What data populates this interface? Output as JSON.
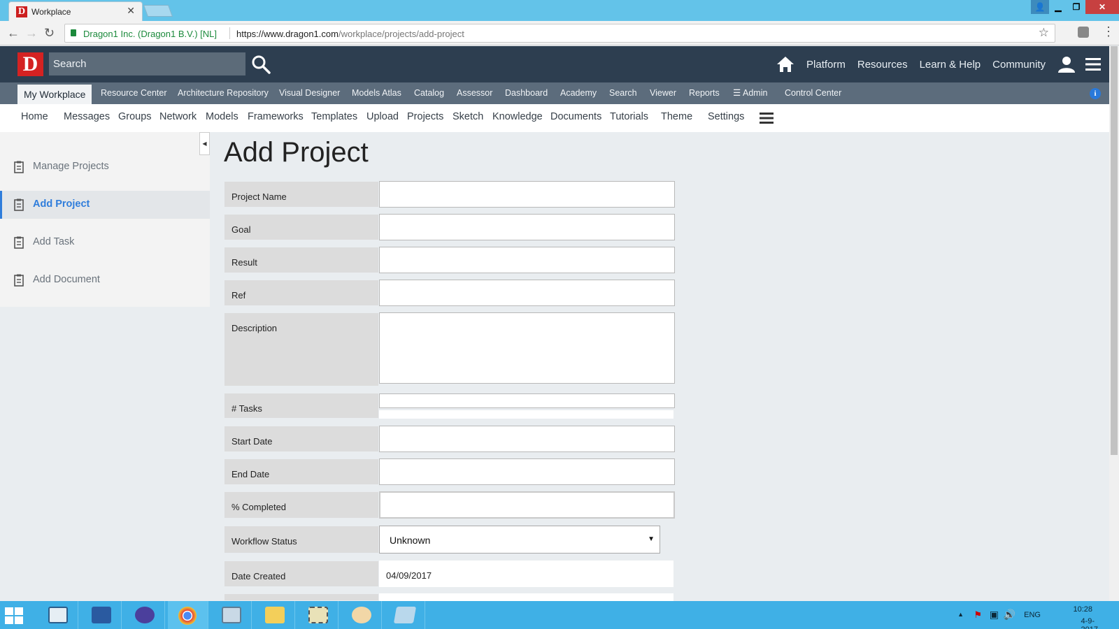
{
  "browser": {
    "tab_title": "Workplace",
    "org": "Dragon1 Inc. (Dragon1 B.V.) [NL]",
    "url_host": "https://www.dragon1.com",
    "url_path": "/workplace/projects/add-project"
  },
  "header": {
    "logo_letter": "D",
    "search_placeholder": "Search",
    "links": [
      "Platform",
      "Resources",
      "Learn & Help",
      "Community"
    ]
  },
  "modules": {
    "active": "My Workplace",
    "items": [
      "Resource Center",
      "Architecture Repository",
      "Visual Designer",
      "Models Atlas",
      "Catalog",
      "Assessor",
      "Dashboard",
      "Academy",
      "Search",
      "Viewer",
      "Reports",
      "Admin",
      "Control Center"
    ]
  },
  "subnav": [
    "Home",
    "Messages",
    "Groups",
    "Network",
    "Models",
    "Frameworks",
    "Templates",
    "Upload",
    "Projects",
    "Sketch",
    "Knowledge",
    "Documents",
    "Tutorials",
    "Theme",
    "Settings"
  ],
  "sidebar": {
    "items": [
      {
        "label": "Manage Projects"
      },
      {
        "label": "Add Project"
      },
      {
        "label": "Add Task"
      },
      {
        "label": "Add Document"
      }
    ]
  },
  "form": {
    "title": "Add Project",
    "fields": {
      "project_name": "Project Name",
      "goal": "Goal",
      "result": "Result",
      "ref": "Ref",
      "description": "Description",
      "tasks": "# Tasks",
      "start_date": "Start Date",
      "end_date": "End Date",
      "completed": "% Completed",
      "workflow_status": "Workflow Status",
      "workflow_status_value": "Unknown",
      "date_created": "Date Created",
      "date_created_value": "04/09/2017"
    }
  },
  "taskbar": {
    "lang": "ENG",
    "time": "10:28",
    "date": "4-9-2017"
  }
}
